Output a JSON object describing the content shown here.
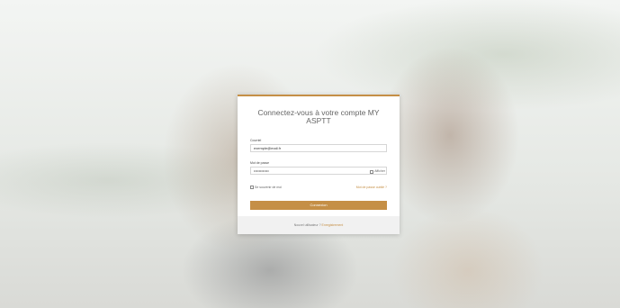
{
  "login": {
    "title": "Connectez-vous à votre compte MY ASPTT",
    "email_label": "Courriel",
    "email_value": "exemple@mail.fr",
    "password_label": "Mot de passe",
    "password_value": "••••••••••••",
    "show_password_label": "Afficher",
    "remember_label": "Se souvenir de moi",
    "forgot_link": "Mot de passe oublié ?",
    "submit_label": "Connexion",
    "footer_text": "Nouvel utilisateur ?",
    "register_link": "Enregistrement"
  },
  "colors": {
    "accent": "#c58f46"
  }
}
